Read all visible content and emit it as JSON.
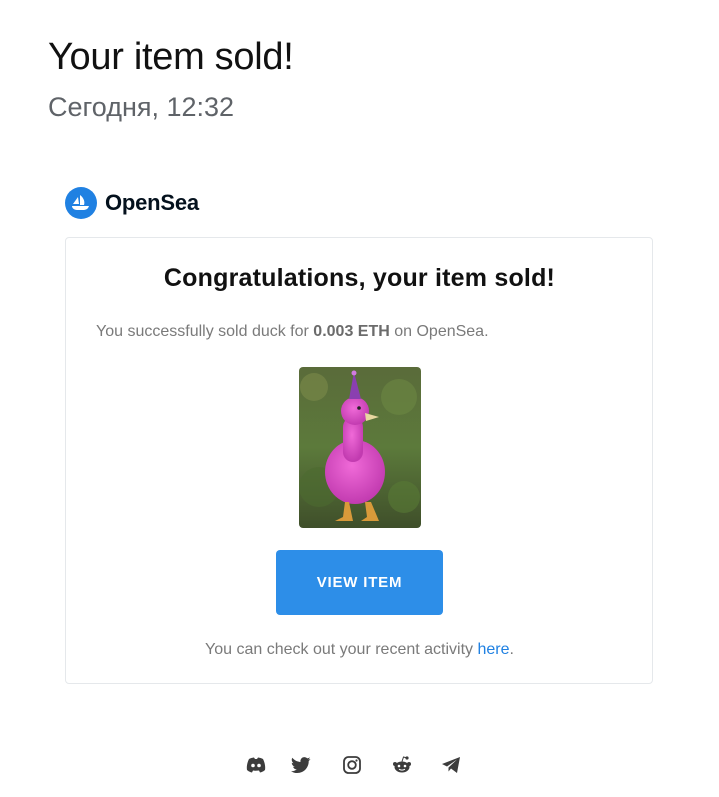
{
  "email": {
    "subject": "Your item sold!",
    "date": "Сегодня, 12:32"
  },
  "brand": {
    "name": "OpenSea",
    "color": "#2081e2"
  },
  "card": {
    "title": "Congratulations, your item sold!",
    "message_prefix": "You successfully sold duck for ",
    "price": "0.003 ETH",
    "message_suffix": " on OpenSea.",
    "image_description_icon": "pink-duck-with-party-hat",
    "button_label": "VIEW ITEM",
    "button_color": "#2d8ee8",
    "activity_prefix": "You can check out your recent activity ",
    "activity_link": "here",
    "activity_suffix": "."
  },
  "footer": {
    "social_icons": [
      "discord-icon",
      "twitter-icon",
      "instagram-icon",
      "reddit-icon",
      "telegram-icon"
    ]
  }
}
